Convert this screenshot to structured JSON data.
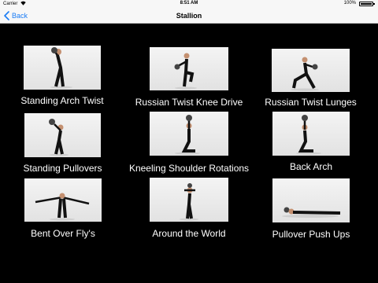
{
  "status": {
    "carrier": "Carrier",
    "time": "8:51 AM",
    "battery": "100%"
  },
  "nav": {
    "back_label": "Back",
    "title": "Stallion"
  },
  "exercises": [
    {
      "label": "Standing Arch Twist"
    },
    {
      "label": "Russian Twist Knee Drive"
    },
    {
      "label": "Russian Twist Lunges"
    },
    {
      "label": "Standing Pullovers"
    },
    {
      "label": "Kneeling Shoulder Rotations"
    },
    {
      "label": "Back Arch"
    },
    {
      "label": "Bent Over Fly's"
    },
    {
      "label": "Around the World"
    },
    {
      "label": "Pullover Push Ups"
    }
  ]
}
